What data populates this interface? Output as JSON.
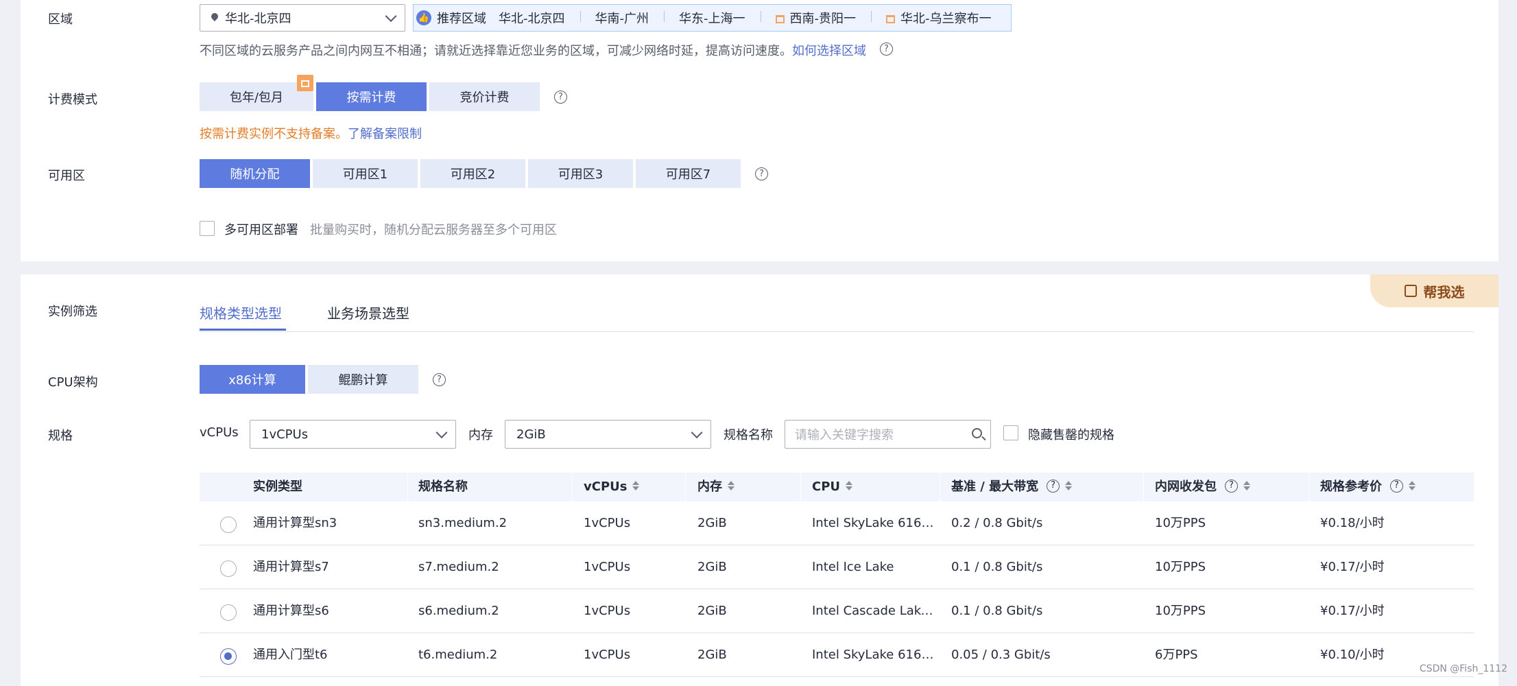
{
  "region": {
    "label": "区域",
    "selected": "华北-北京四",
    "recommend_label": "推荐区域",
    "recommended": [
      "华北-北京四",
      "华南-广州",
      "华东-上海一",
      "西南-贵阳一",
      "华北-乌兰察布一"
    ],
    "hint": "不同区域的云服务产品之间内网互不相通；请就近选择靠近您业务的区域，可减少网络时延，提高访问速度。",
    "hint_link": "如何选择区域"
  },
  "billing": {
    "label": "计费模式",
    "options": [
      "包年/包月",
      "按需计费",
      "竞价计费"
    ],
    "selected_index": 1,
    "warning": "按需计费实例不支持备案。",
    "warning_link": "了解备案限制"
  },
  "az": {
    "label": "可用区",
    "options": [
      "随机分配",
      "可用区1",
      "可用区2",
      "可用区3",
      "可用区7"
    ],
    "selected_index": 0,
    "multi_az_label": "多可用区部署",
    "multi_az_hint": "批量购买时，随机分配云服务器至多个可用区"
  },
  "filter": {
    "label": "实例筛选",
    "tabs": [
      "规格类型选型",
      "业务场景选型"
    ],
    "active_tab": 0,
    "help_button": "帮我选"
  },
  "cpu_arch": {
    "label": "CPU架构",
    "options": [
      "x86计算",
      "鲲鹏计算"
    ],
    "selected_index": 0
  },
  "spec": {
    "label": "规格",
    "vcpus_label": "vCPUs",
    "vcpus_value": "1vCPUs",
    "memory_label": "内存",
    "memory_value": "2GiB",
    "name_label": "规格名称",
    "name_placeholder": "请输入关键字搜索",
    "hide_soldout_label": "隐藏售罄的规格"
  },
  "table": {
    "headers": [
      "实例类型",
      "规格名称",
      "vCPUs",
      "内存",
      "CPU",
      "基准 / 最大带宽",
      "内网收发包",
      "规格参考价"
    ],
    "rows": [
      {
        "type": "通用计算型sn3",
        "name": "sn3.medium.2",
        "vcpus": "1vCPUs",
        "mem": "2GiB",
        "cpu": "Intel SkyLake 6161...",
        "bw": "0.2 / 0.8 Gbit/s",
        "pps": "10万PPS",
        "price": "¥0.18/小时",
        "selected": false
      },
      {
        "type": "通用计算型s7",
        "name": "s7.medium.2",
        "vcpus": "1vCPUs",
        "mem": "2GiB",
        "cpu": "Intel Ice Lake",
        "bw": "0.1 / 0.8 Gbit/s",
        "pps": "10万PPS",
        "price": "¥0.17/小时",
        "selected": false
      },
      {
        "type": "通用计算型s6",
        "name": "s6.medium.2",
        "vcpus": "1vCPUs",
        "mem": "2GiB",
        "cpu": "Intel Cascade Lake...",
        "bw": "0.1 / 0.8 Gbit/s",
        "pps": "10万PPS",
        "price": "¥0.17/小时",
        "selected": false
      },
      {
        "type": "通用入门型t6",
        "name": "t6.medium.2",
        "vcpus": "1vCPUs",
        "mem": "2GiB",
        "cpu": "Intel SkyLake 6161...",
        "bw": "0.05 / 0.3 Gbit/s",
        "pps": "6万PPS",
        "price": "¥0.10/小时",
        "selected": true
      }
    ]
  },
  "watermark": "CSDN @Fish_1112",
  "colors": {
    "primary": "#5e7ce0",
    "link": "#526ecc",
    "warning": "#e37d29",
    "help_bg": "#f8e4c9"
  }
}
